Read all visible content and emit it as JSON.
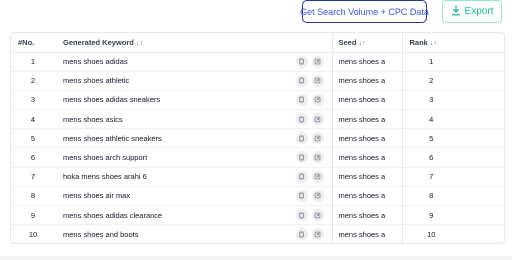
{
  "toolbar": {
    "volume_button_label": "Get Search Volume + CPC Data",
    "export_label": "Export",
    "export_icon": "download-icon",
    "accent_color": "#20b89a",
    "volume_color": "#1e3a8a"
  },
  "table": {
    "headers": {
      "no": "#No.",
      "keyword": "Generated Keyword",
      "seed": "Seed",
      "rank": "Rank",
      "sort_indicator": "↓↑"
    },
    "row_icons": [
      "copy-icon",
      "external-link-icon"
    ],
    "rows": [
      {
        "no": "1",
        "keyword": "mens shoes adidas",
        "seed": "mens shoes a",
        "rank": "1"
      },
      {
        "no": "2",
        "keyword": "mens shoes athletic",
        "seed": "mens shoes a",
        "rank": "2"
      },
      {
        "no": "3",
        "keyword": "mens shoes adidas sneakers",
        "seed": "mens shoes a",
        "rank": "3"
      },
      {
        "no": "4",
        "keyword": "mens shoes asics",
        "seed": "mens shoes a",
        "rank": "4"
      },
      {
        "no": "5",
        "keyword": "mens shoes athletic sneakers",
        "seed": "mens shoes a",
        "rank": "5"
      },
      {
        "no": "6",
        "keyword": "mens shoes arch support",
        "seed": "mens shoes a",
        "rank": "6"
      },
      {
        "no": "7",
        "keyword": "hoka mens shoes arahi 6",
        "seed": "mens shoes a",
        "rank": "7"
      },
      {
        "no": "8",
        "keyword": "mens shoes air max",
        "seed": "mens shoes a",
        "rank": "8"
      },
      {
        "no": "9",
        "keyword": "mens shoes adidas clearance",
        "seed": "mens shoes a",
        "rank": "9"
      },
      {
        "no": "10",
        "keyword": "mens shoes and boots",
        "seed": "mens shoes a",
        "rank": "10"
      }
    ]
  }
}
